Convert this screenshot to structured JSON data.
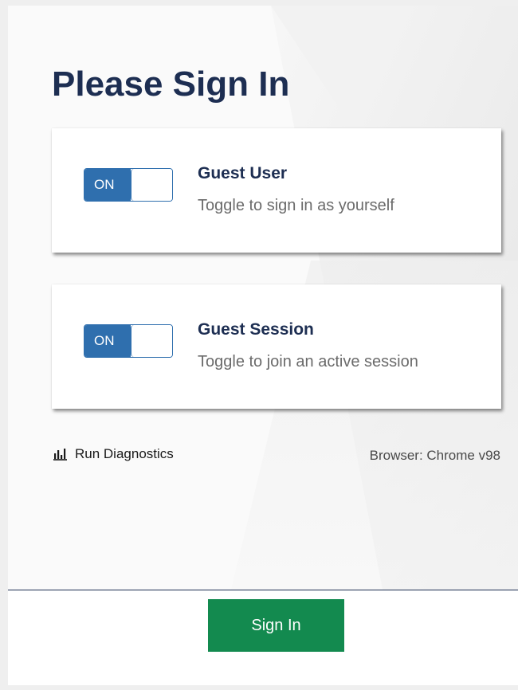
{
  "page": {
    "title": "Please Sign In"
  },
  "cards": [
    {
      "toggle_label": "ON",
      "toggle_on": true,
      "title": "Guest User",
      "subtitle": "Toggle to sign in as yourself"
    },
    {
      "toggle_label": "ON",
      "toggle_on": true,
      "title": "Guest Session",
      "subtitle": "Toggle to join an active session"
    }
  ],
  "diagnostics": {
    "label": "Run Diagnostics",
    "icon": "bar-chart-icon"
  },
  "browser_info": "Browser: Chrome v98",
  "footer": {
    "sign_in_label": "Sign In"
  },
  "colors": {
    "title": "#1d2e52",
    "toggle_accent": "#2f6fae",
    "sign_in_button": "#138a4f",
    "divider": "#1d2e52"
  }
}
